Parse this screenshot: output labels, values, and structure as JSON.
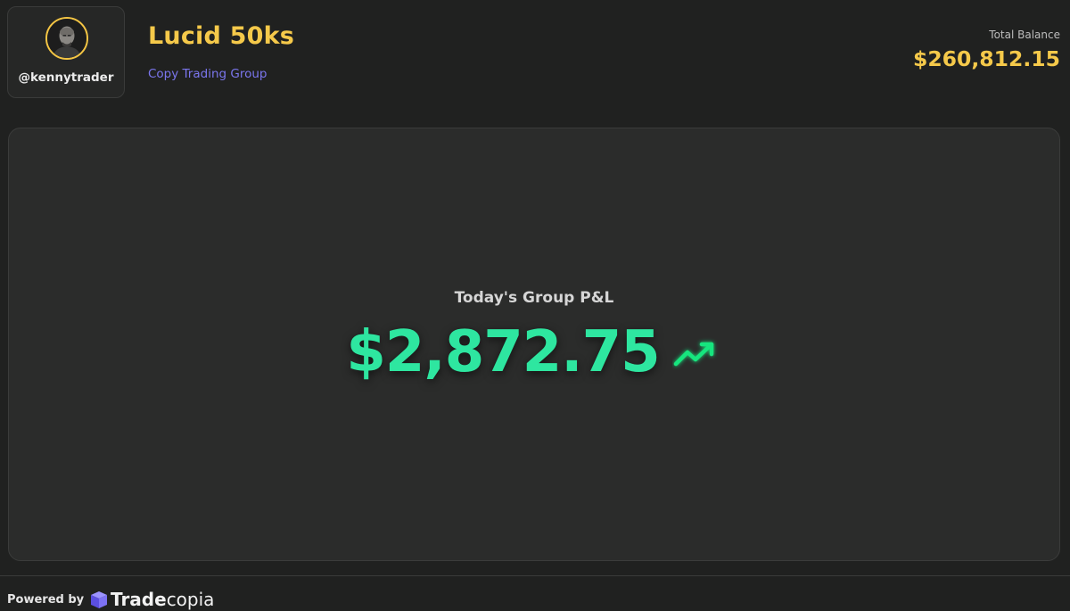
{
  "profile": {
    "username": "@kennytrader",
    "avatar_icon": "user-avatar",
    "avatar_border_color": "#f4c544"
  },
  "group": {
    "title": "Lucid 50ks",
    "subtitle": "Copy Trading Group"
  },
  "balance": {
    "label": "Total Balance",
    "value": "$260,812.15"
  },
  "pnl": {
    "label": "Today's Group P&L",
    "value": "$2,872.75",
    "trend_icon": "trending-up-icon",
    "color": "#2ee6a0"
  },
  "footer": {
    "powered_by": "Powered by",
    "brand_strong": "Trade",
    "brand_light": "copia",
    "brand_icon": "tradecopia-logo-icon"
  },
  "colors": {
    "background": "#202120",
    "accent_gold": "#f5c94a",
    "accent_purple": "#7b76ee",
    "profit_green": "#2ee6a0"
  }
}
